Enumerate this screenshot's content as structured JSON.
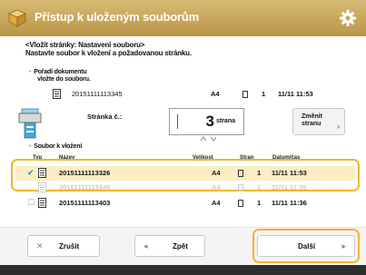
{
  "window": {
    "title": "Přístup k uloženým souborům",
    "icon": "box-icon",
    "settings_icon": "gear-icon",
    "accent_color": "#c8a75c",
    "highlight_color": "#f0b72b"
  },
  "instructions": {
    "line1": "<Vložit stránky: Nastavení souboru>",
    "line2": "Nastavte soubor k vložení a požadovanou stránku."
  },
  "target_section": {
    "header_line1": "Pořadí dokumentu",
    "header_line2": "vložte do souboru.",
    "file": {
      "name": "20151111113345",
      "size": "A4",
      "pages": "1",
      "date": "11/11 11:53"
    }
  },
  "insert_position": {
    "label": "Stránka č.:",
    "value": "3",
    "unit": "strana",
    "change_button": "Změnit stranu"
  },
  "file_list": {
    "header": "Soubor k vložení",
    "columns": [
      "Typ",
      "Název",
      "Velikost",
      "Stran",
      "Datum/čas"
    ],
    "rows": [
      {
        "name": "20151111113326",
        "size": "A4",
        "pages": "1",
        "date": "11/11 11:53",
        "selected": true,
        "faded": false
      },
      {
        "name": "20151111113345",
        "size": "A4",
        "pages": "1",
        "date": "11/11 11:35",
        "selected": false,
        "faded": true
      },
      {
        "name": "20151111113403",
        "size": "A4",
        "pages": "1",
        "date": "11/11 11:36",
        "selected": false,
        "faded": false
      }
    ]
  },
  "buttons": {
    "cancel": "Zrušit",
    "back": "Zpět",
    "next": "Další"
  }
}
